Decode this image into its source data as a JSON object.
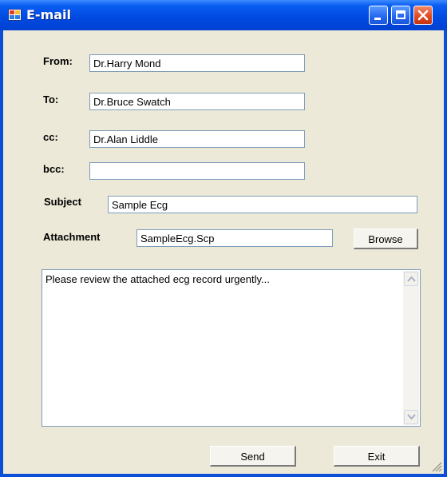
{
  "window": {
    "title": "E-mail"
  },
  "form": {
    "from_label": "From:",
    "from_value": "Dr.Harry Mond",
    "to_label": "To:",
    "to_value": "Dr.Bruce Swatch",
    "cc_label": "cc:",
    "cc_value": "Dr.Alan Liddle",
    "bcc_label": "bcc:",
    "bcc_value": "",
    "subject_label": "Subject",
    "subject_value": "Sample Ecg",
    "attachment_label": "Attachment",
    "attachment_value": "SampleEcg.Scp",
    "browse_label": "Browse",
    "body_text": "Please review the attached ecg record urgently..."
  },
  "actions": {
    "send_label": "Send",
    "exit_label": "Exit"
  },
  "colors": {
    "titlebar": "#0049e0",
    "close_button": "#e04a22",
    "client_background": "#ece9d8",
    "input_border": "#7f9db9"
  },
  "icons": [
    "app-icon",
    "minimize-icon",
    "maximize-icon",
    "close-icon",
    "scroll-up-arrow-icon",
    "scroll-down-arrow-icon",
    "resize-grip-icon"
  ]
}
